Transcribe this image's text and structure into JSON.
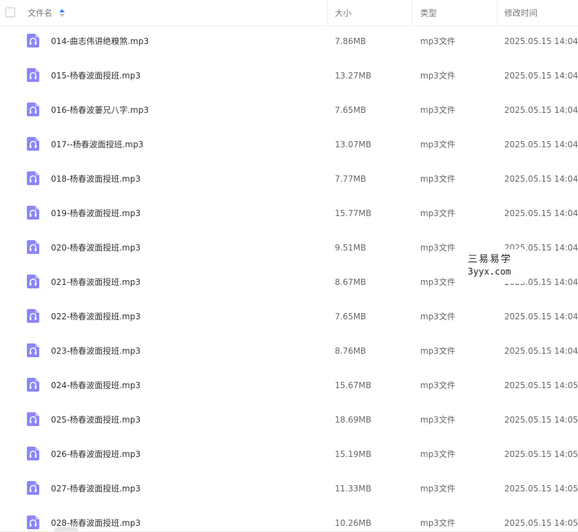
{
  "header": {
    "name_label": "文件名",
    "size_label": "大小",
    "type_label": "类型",
    "time_label": "修改时间"
  },
  "files": [
    {
      "name": "014-曲志伟讲绝糗煞.mp3",
      "size": "7.86MB",
      "type": "mp3文件",
      "time": "2025.05.15 14:04"
    },
    {
      "name": "015-杨春波面授班.mp3",
      "size": "13.27MB",
      "type": "mp3文件",
      "time": "2025.05.15 14:04"
    },
    {
      "name": "016-杨春波萋兄八字.mp3",
      "size": "7.65MB",
      "type": "mp3文件",
      "time": "2025.05.15 14:04"
    },
    {
      "name": "017--杨春波面授班.mp3",
      "size": "13.07MB",
      "type": "mp3文件",
      "time": "2025.05.15 14:04"
    },
    {
      "name": "018-杨春波面授班.mp3",
      "size": "7.77MB",
      "type": "mp3文件",
      "time": "2025.05.15 14:04"
    },
    {
      "name": "019-杨春波面授班.mp3",
      "size": "15.77MB",
      "type": "mp3文件",
      "time": "2025.05.15 14:04"
    },
    {
      "name": "020-杨春波面授班.mp3",
      "size": "9.51MB",
      "type": "mp3文件",
      "time": "2025.05.15 14:04"
    },
    {
      "name": "021-杨春波面授班.mp3",
      "size": "8.67MB",
      "type": "mp3文件",
      "time": "2025.05.15 14:04"
    },
    {
      "name": "022-杨春波面授班.mp3",
      "size": "7.65MB",
      "type": "mp3文件",
      "time": "2025.05.15 14:04"
    },
    {
      "name": "023-杨春波面授班.mp3",
      "size": "8.76MB",
      "type": "mp3文件",
      "time": "2025.05.15 14:04"
    },
    {
      "name": "024-杨春波面授班.mp3",
      "size": "15.67MB",
      "type": "mp3文件",
      "time": "2025.05.15 14:05"
    },
    {
      "name": "025-杨春波面授班.mp3",
      "size": "18.69MB",
      "type": "mp3文件",
      "time": "2025.05.15 14:05"
    },
    {
      "name": "026-杨春波面授班.mp3",
      "size": "15.19MB",
      "type": "mp3文件",
      "time": "2025.05.15 14:05"
    },
    {
      "name": "027-杨春波面授班.mp3",
      "size": "11.33MB",
      "type": "mp3文件",
      "time": "2025.05.15 14:05"
    },
    {
      "name": "028-杨春波面授班.mp3",
      "size": "10.26MB",
      "type": "mp3文件",
      "time": "2025.05.15 14:05"
    }
  ],
  "watermark": {
    "line1": "三易易学",
    "line2": "3yyx.com"
  },
  "icons": {
    "file_icon": "audio-file-icon",
    "sort_icon": "sort-ascending-icon"
  },
  "colors": {
    "file_icon": "#8c86f5",
    "sort_active": "#2d8cf0",
    "sort_inactive": "#c5c5c5"
  }
}
